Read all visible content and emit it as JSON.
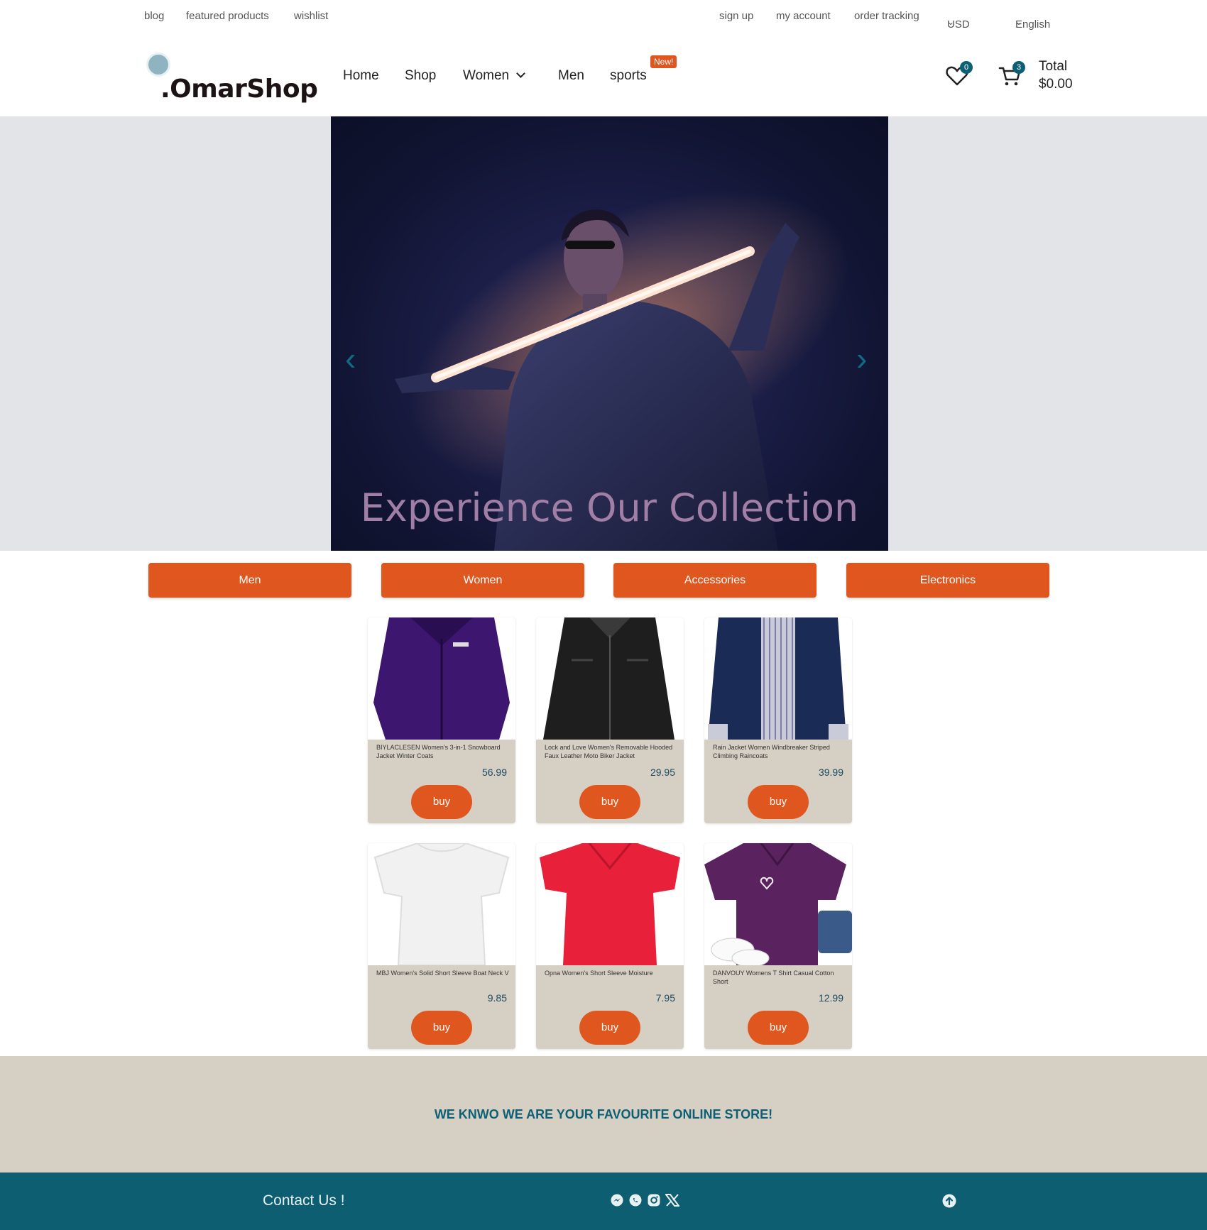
{
  "topbar": {
    "blog": "blog",
    "featured": "featured products",
    "wishlist": "wishlist",
    "signup": "sign up",
    "account": "my account",
    "tracking": "order tracking",
    "currency": "USD",
    "language": "English"
  },
  "brand": {
    "name": ".OmarShop"
  },
  "nav": {
    "home": "Home",
    "shop": "Shop",
    "women": "Women",
    "men": "Men",
    "sports": "sports",
    "sports_badge": "New!"
  },
  "cart": {
    "wishlist_count": "0",
    "cart_count": "3",
    "total_label": "Total",
    "total_value": "$0.00"
  },
  "hero": {
    "caption": "Experience Our Collection",
    "prev": "‹",
    "next": "›"
  },
  "categories": [
    "Men",
    "Women",
    "Accessories",
    "Electronics"
  ],
  "products": [
    {
      "title": "BIYLACLESEN Women's 3-in-1 Snowboard Jacket Winter Coats",
      "price": "56.99",
      "buy": "buy"
    },
    {
      "title": "Lock and Love Women's Removable Hooded Faux Leather Moto Biker Jacket",
      "price": "29.95",
      "buy": "buy"
    },
    {
      "title": "Rain Jacket Women Windbreaker Striped Climbing Raincoats",
      "price": "39.99",
      "buy": "buy"
    },
    {
      "title": "MBJ Women's Solid Short Sleeve Boat Neck V",
      "price": "9.85",
      "buy": "buy"
    },
    {
      "title": "Opna Women's Short Sleeve Moisture",
      "price": "7.95",
      "buy": "buy"
    },
    {
      "title": "DANVOUY Womens T Shirt Casual Cotton Short",
      "price": "12.99",
      "buy": "buy"
    }
  ],
  "banner": {
    "slogan": "WE KNWO WE ARE YOUR FAVOURITE ONLINE STORE!"
  },
  "footer": {
    "contact": "Contact Us !"
  },
  "icons": [
    "heart-icon",
    "cart-icon",
    "messenger-icon",
    "whatsapp-icon",
    "instagram-icon",
    "x-icon",
    "arrow-up-icon"
  ],
  "colors": {
    "accent": "#e0561f",
    "teal": "#0e5e71",
    "beige": "#d6cfc4"
  }
}
